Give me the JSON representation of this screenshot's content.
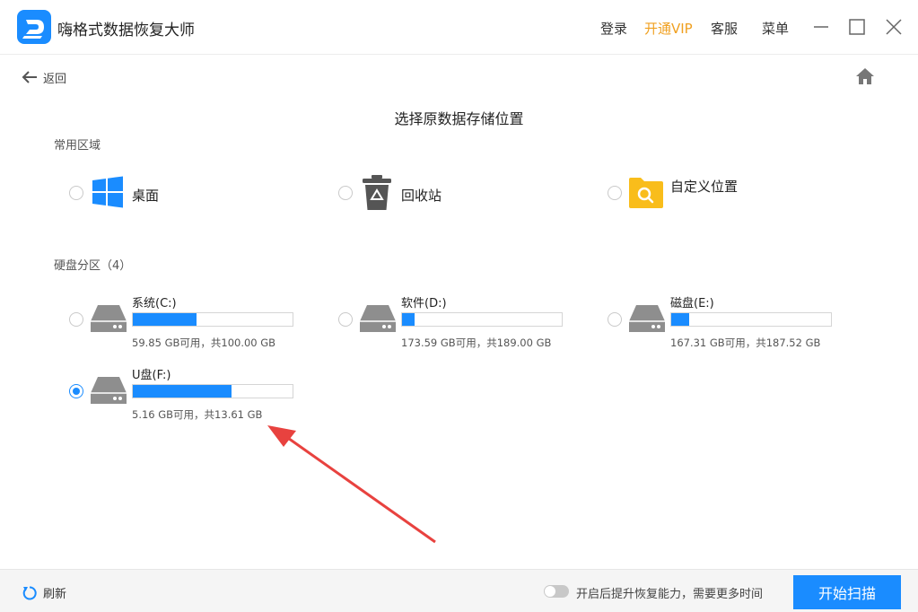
{
  "app": {
    "title": "嗨格式数据恢复大师",
    "nav": {
      "login": "登录",
      "vip": "开通VIP",
      "service": "客服",
      "menu": "菜单"
    }
  },
  "header": {
    "back_label": "返回"
  },
  "page_title": "选择原数据存储位置",
  "common": {
    "label": "常用区域",
    "items": [
      {
        "label": "桌面",
        "icon": "windows-icon"
      },
      {
        "label": "回收站",
        "icon": "recycle-bin-icon"
      },
      {
        "label": "自定义位置",
        "icon": "folder-search-icon"
      }
    ]
  },
  "partitions": {
    "label": "硬盘分区（4）",
    "drives": [
      {
        "name": "系统(C:)",
        "info": "59.85 GB可用，共100.00 GB",
        "used_fraction": 0.4,
        "selected": false
      },
      {
        "name": "软件(D:)",
        "info": "173.59 GB可用，共189.00 GB",
        "used_fraction": 0.08,
        "selected": false
      },
      {
        "name": "磁盘(E:)",
        "info": "167.31 GB可用，共187.52 GB",
        "used_fraction": 0.11,
        "selected": false
      },
      {
        "name": "U盘(F:)",
        "info": "5.16 GB可用，共13.61 GB",
        "used_fraction": 0.62,
        "selected": true
      }
    ]
  },
  "footer": {
    "refresh_label": "刷新",
    "toggle_label": "开启后提升恢复能力，需要更多时间",
    "toggle_on": false,
    "scan_label": "开始扫描"
  },
  "colors": {
    "accent": "#1a8cff",
    "vip": "#f0a020",
    "annotation": "#e8423f"
  }
}
